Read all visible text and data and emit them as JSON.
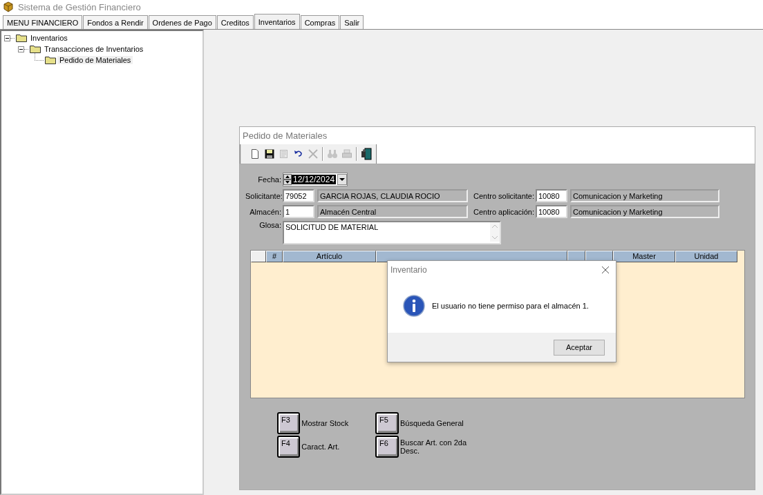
{
  "window": {
    "title": "Sistema de Gestión Financiero"
  },
  "tabs": [
    {
      "label": "MENU FINANCIERO",
      "selected": false
    },
    {
      "label": "Fondos a Rendir",
      "selected": false
    },
    {
      "label": "Ordenes de Pago",
      "selected": false
    },
    {
      "label": "Creditos",
      "selected": false
    },
    {
      "label": "Inventarios",
      "selected": true
    },
    {
      "label": "Compras",
      "selected": false
    },
    {
      "label": "Salir",
      "selected": false
    }
  ],
  "tree": [
    {
      "label": "Inventarios",
      "expanded": true,
      "selected": false,
      "children": [
        {
          "label": "Transacciones de Inventarios",
          "expanded": true,
          "selected": false,
          "children": [
            {
              "label": "Pedido de Materiales",
              "selected": true
            }
          ]
        }
      ]
    }
  ],
  "child_window": {
    "title": "Pedido de Materiales",
    "toolbar": [
      {
        "kind": "new",
        "disabled": false
      },
      {
        "kind": "save",
        "disabled": false
      },
      {
        "kind": "edit",
        "disabled": true
      },
      {
        "kind": "undo",
        "disabled": false
      },
      {
        "kind": "delete",
        "disabled": true
      },
      {
        "kind": "sep"
      },
      {
        "kind": "find",
        "disabled": true
      },
      {
        "kind": "print",
        "disabled": true
      },
      {
        "kind": "sep"
      },
      {
        "kind": "exit",
        "disabled": false
      }
    ],
    "fecha": {
      "label": "Fecha:",
      "value": "12/12/2024"
    },
    "solicitante": {
      "label": "Solicitante:",
      "code": "79052",
      "name": "GARCIA ROJAS, CLAUDIA ROCIO"
    },
    "almacen": {
      "label": "Almacén:",
      "code": "1",
      "name": "Almacén Central"
    },
    "centro_solicitante": {
      "label": "Centro solicitante:",
      "code": "10080",
      "name": "Comunicacion y Marketing"
    },
    "centro_aplicacion": {
      "label": "Centro aplicación:",
      "code": "10080",
      "name": "Comunicacion y Marketing"
    },
    "glosa": {
      "label": "Glosa:",
      "value": "SOLICITUD DE MATERIAL"
    },
    "table": {
      "columns": [
        {
          "kind": "blank"
        },
        {
          "kind": "text",
          "label": "#"
        },
        {
          "kind": "text",
          "label": "Artículo"
        },
        {
          "kind": "covered"
        },
        {
          "kind": "covered"
        },
        {
          "kind": "covered"
        },
        {
          "kind": "text",
          "label": "Master"
        },
        {
          "kind": "text",
          "label": "Unidad"
        }
      ]
    },
    "function_keys": [
      {
        "key": "F3",
        "label": "Mostrar Stock"
      },
      {
        "key": "F5",
        "label": "Búsqueda General"
      },
      {
        "key": "F4",
        "label": "Caract. Art."
      },
      {
        "key": "F6",
        "label": "Buscar Art. con 2da Desc."
      }
    ]
  },
  "dialog": {
    "title": "Inventario",
    "message": "El usuario no tiene permiso para el almacén 1.",
    "buttons": [
      "Aceptar"
    ]
  }
}
